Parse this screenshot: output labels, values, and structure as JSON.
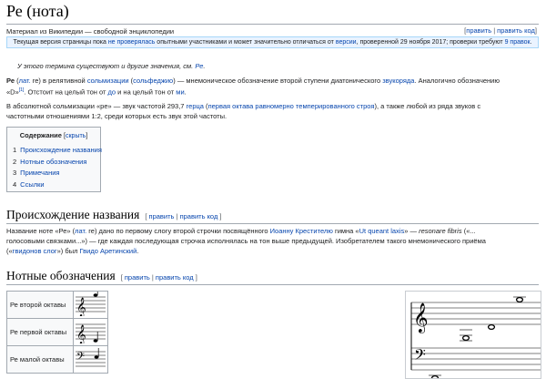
{
  "title": "Ре (нота)",
  "tagline": "Материал из Википедии — свободной энциклопедии",
  "edit_links": {
    "edit": "править",
    "edit_code": "править код"
  },
  "notice": {
    "p1": "Текущая версия страницы пока ",
    "link1": "не проверялась",
    "p2": " опытными участниками и может значительно отличаться от ",
    "link2": "версии",
    "p3": ", проверенной 29 ноября 2017; проверки требуют ",
    "link3": "9 правок",
    "p4": "."
  },
  "hatnote": {
    "text": "У этого термина существуют и другие значения, см. ",
    "link": "Ре",
    "end": "."
  },
  "para1": {
    "bold": "Ре",
    "t1": " (",
    "lat": "лат.",
    "t2": " re) в релятивной ",
    "solm": "сольмизации",
    "t3": " (",
    "solf": "сольфеджио",
    "t4": ") — мнемоническое обозначение второй ступени диатонического ",
    "zvuk": "звукоряда",
    "t5": ". Аналогично обозначению",
    "t6": "«D»",
    "ref": "[1]",
    "t7": ". Отстоит на целый тон от ",
    "do": "до",
    "t8": " и на целый тон от ",
    "mi": "ми",
    "t9": "."
  },
  "para2": {
    "t1": "В абсолютной сольмизации «ре» — звук частотой 293,7 ",
    "herz": "герца",
    "t2": " (",
    "oct": "первая октава",
    "t3": " ",
    "temp": "равномерно темперированного строя",
    "t4": "), а также любой из ряда звуков с",
    "t5": "частотными отношениями 1:2, среди которых есть звук этой частоты."
  },
  "toc": {
    "title": "Содержание",
    "toggle_open": "[",
    "toggle": "скрыть",
    "toggle_close": "]",
    "items": [
      {
        "num": "1",
        "label": "Происхождение названия"
      },
      {
        "num": "2",
        "label": "Нотные обозначения"
      },
      {
        "num": "3",
        "label": "Примечания"
      },
      {
        "num": "4",
        "label": "Ссылки"
      }
    ]
  },
  "section1": {
    "title": "Происхождение названия",
    "edit_open": "[ ",
    "edit": "править",
    "sep": " | ",
    "edit_code": "править код",
    "edit_close": " ]"
  },
  "para3": {
    "t1": "Название ноте «Ре» (",
    "lat": "лат.",
    "t2": " re) дано по первому слогу второй строчки посвящённого ",
    "ioann": "Иоанну Крестителю",
    "t3": " гимна «",
    "ut": "Ut queant laxis",
    "t4": "» — ",
    "resonare": "resonare fibris",
    "t5": " («...",
    "t6": "голосовыми связками...») — где каждая последующая строчка исполнялась на тон выше предыдущей. Изобретателем такого мнемонического приёма",
    "t7": "(«",
    "gvidonov": "гвидонов слог",
    "t8": "») был ",
    "guido": "Гвидо Аретинский",
    "t9": "."
  },
  "section2": {
    "title": "Нотные обозначения",
    "edit_open": "[ ",
    "edit": "править",
    "sep": " | ",
    "edit_code": "править код",
    "edit_close": " ]"
  },
  "notes_table": [
    {
      "label": "Ре второй октавы",
      "clef": "treble"
    },
    {
      "label": "Ре первой октавы",
      "clef": "treble"
    },
    {
      "label": "Ре малой октавы",
      "clef": "bass"
    }
  ]
}
